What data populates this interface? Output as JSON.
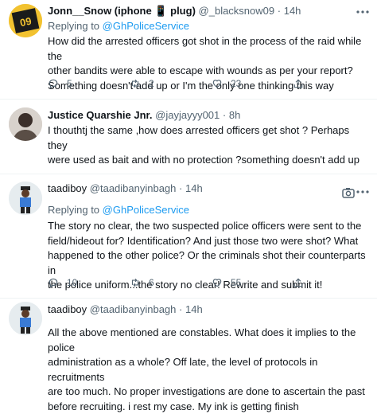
{
  "tweets": [
    {
      "name": "Jonn__Snow (iphone 📱 plug)",
      "handle": "@_blacksnow09",
      "separator": "·",
      "time": "14h",
      "replying_prefix": "Replying to",
      "replying_to": "@GhPoliceService",
      "lines": [
        "How did the arrested officers got shot in the process of the raid while the",
        "other bandits were able to escape with wounds as per your report?",
        "Something doesn't add up or I'm the only one thinking this way"
      ],
      "replies": "5",
      "retweets": "2",
      "likes": "23"
    },
    {
      "name": "Justice Quarshie Jnr.",
      "handle": "@jayjayyy001",
      "separator": "·",
      "time": "8h",
      "lines": [
        "I thouthtj the same ,how does arrested  officers get shot ? Perhaps they",
        "were used as bait and with no protection ?something doesn't add up"
      ]
    },
    {
      "name": "taadiboy",
      "handle": "@taadibanyinbagh",
      "separator": "·",
      "time": "14h",
      "replying_prefix": "Replying to",
      "replying_to": "@GhPoliceService",
      "lines": [
        "The story no clear, the two suspected police officers were sent to the",
        "field/hideout for? Identification? And just those two were shot? What",
        "happened to the other police? Or the criminals shot their counterparts in",
        "the police uniform...the story no clear! Rewrite and submit it!"
      ],
      "replies": "10",
      "retweets": "6",
      "likes": "55"
    },
    {
      "name": "taadiboy",
      "handle": "@taadibanyinbagh",
      "separator": "·",
      "time": "14h",
      "lines": [
        "All the above mentioned are constables. What does it implies to the police",
        "administration as a whole? Off late, the level of protocols in recruitments",
        "are too much. No proper investigations are done to ascertain the past",
        "before recruiting. i rest my case. My ink is getting finish"
      ]
    }
  ],
  "colors": {
    "link": "#1d9bf0",
    "secondary": "#536471",
    "text": "#0f1419",
    "divider": "#eff3f4"
  }
}
